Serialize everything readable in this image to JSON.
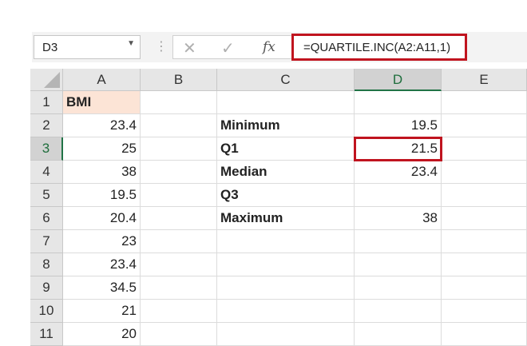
{
  "formula_bar": {
    "name_box": "D3",
    "separator": "⋮",
    "cancel_glyph": "✕",
    "enter_glyph": "✓",
    "fx_label": "fx",
    "formula": "=QUARTILE.INC(A2:A11,1)"
  },
  "columns": [
    "A",
    "B",
    "C",
    "D",
    "E"
  ],
  "selected_column": "D",
  "rows": [
    {
      "num": "1",
      "A": "BMI",
      "B": "",
      "C": "",
      "D": "",
      "E": ""
    },
    {
      "num": "2",
      "A": "23.4",
      "B": "",
      "C": "Minimum",
      "D": "19.5",
      "E": ""
    },
    {
      "num": "3",
      "A": "25",
      "B": "",
      "C": "Q1",
      "D": "21.5",
      "E": ""
    },
    {
      "num": "4",
      "A": "38",
      "B": "",
      "C": "Median",
      "D": "23.4",
      "E": ""
    },
    {
      "num": "5",
      "A": "19.5",
      "B": "",
      "C": "Q3",
      "D": "",
      "E": ""
    },
    {
      "num": "6",
      "A": "20.4",
      "B": "",
      "C": "Maximum",
      "D": "38",
      "E": ""
    },
    {
      "num": "7",
      "A": "23",
      "B": "",
      "C": "",
      "D": "",
      "E": ""
    },
    {
      "num": "8",
      "A": "23.4",
      "B": "",
      "C": "",
      "D": "",
      "E": ""
    },
    {
      "num": "9",
      "A": "34.5",
      "B": "",
      "C": "",
      "D": "",
      "E": ""
    },
    {
      "num": "10",
      "A": "21",
      "B": "",
      "C": "",
      "D": "",
      "E": ""
    },
    {
      "num": "11",
      "A": "20",
      "B": "",
      "C": "",
      "D": "",
      "E": ""
    }
  ],
  "selected_row": "3",
  "colors": {
    "highlight_red": "#c0141f",
    "header_fill": "#fce4d6",
    "selection_green": "#217346"
  }
}
